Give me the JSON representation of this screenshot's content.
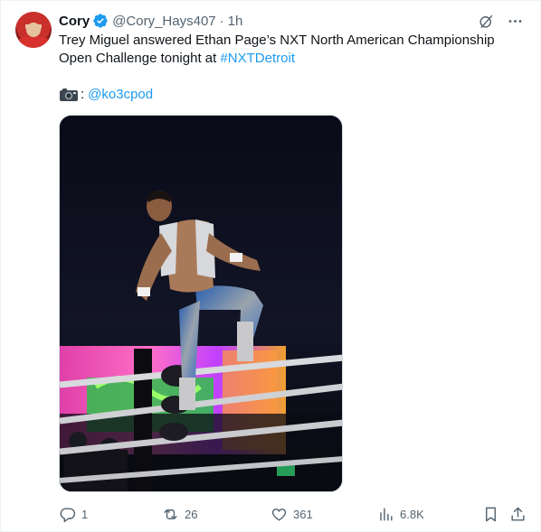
{
  "tweet": {
    "author_name": "Cory",
    "handle": "@Cory_Hays407",
    "separator": "·",
    "time": "1h",
    "text_line1": "Trey Miguel answered Ethan Page’s NXT North American Championship",
    "text_line2_plain": "Open Challenge tonight at ",
    "hashtag": "#NXTDetroit",
    "credit_colon": ":",
    "credit_handle": "@ko3cpod"
  },
  "icons": {
    "verified": "verified-badge-icon",
    "grok": "grok-icon",
    "more": "more-icon",
    "camera": "camera-icon",
    "reply": "reply-icon",
    "retweet": "retweet-icon",
    "like": "like-icon",
    "views": "views-icon",
    "bookmark": "bookmark-icon",
    "share": "share-icon"
  },
  "stats": {
    "replies": "1",
    "retweets": "26",
    "likes": "361",
    "views": "6.8K"
  },
  "colors": {
    "link": "#1d9bf0",
    "secondary_text": "#536471",
    "verified": "#1d9bf0"
  }
}
